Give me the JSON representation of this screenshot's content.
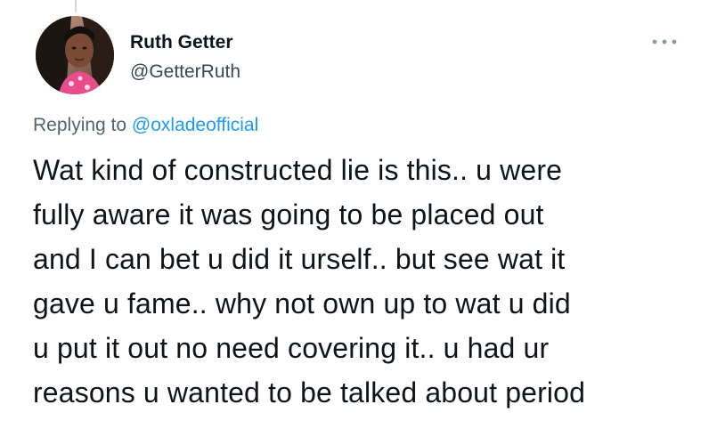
{
  "tweet": {
    "author": {
      "display_name": "Ruth Getter",
      "handle": "@GetterRuth",
      "avatar_icon": "profile-photo"
    },
    "reply_context": {
      "prefix": "Replying to",
      "mention": "@oxladeofficial"
    },
    "text_lines": [
      "Wat kind of constructed lie is this.. u were",
      "fully aware it was going to be placed out",
      "and I can bet u did it urself.. but see wat it",
      "gave u fame.. why not own up to wat u did",
      "u put it out no need covering it.. u had ur",
      "reasons u wanted to be talked about period"
    ],
    "more_icon": "more-horizontal-icon"
  },
  "colors": {
    "text": "#0f1419",
    "secondary": "#536471",
    "link": "#1d9bf0",
    "thread_line": "#cfd9de"
  }
}
